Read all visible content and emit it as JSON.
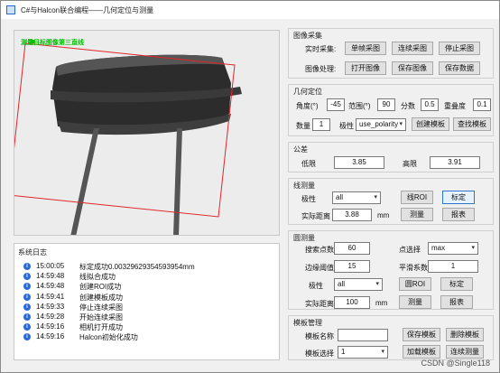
{
  "window": {
    "title": "C#与Halcon联合编程——几何定位与测量"
  },
  "viewer": {
    "overlay_text": "测量目标图像第三直线"
  },
  "system_log": {
    "title": "系统日志",
    "entries": [
      {
        "time": "15:00:05",
        "message": "标定成功0.0032962935459395​4mm"
      },
      {
        "time": "14:59:48",
        "message": "线拟合成功"
      },
      {
        "time": "14:59:48",
        "message": "创建ROI成功"
      },
      {
        "time": "14:59:41",
        "message": "创建模板成功"
      },
      {
        "time": "14:59:33",
        "message": "停止连续采图"
      },
      {
        "time": "14:59:28",
        "message": "开始连续采图"
      },
      {
        "time": "14:59:16",
        "message": "相机打开成功"
      },
      {
        "time": "14:59:16",
        "message": "Halcon初始化成功"
      }
    ]
  },
  "image_acquisition": {
    "title": "图像采集",
    "realtime_label": "实时采集:",
    "single_capture": "单帧采图",
    "continuous_capture": "连续采图",
    "stop_capture": "停止采图",
    "processing_label": "图像处理:",
    "open_image": "打开图像",
    "save_image": "保存图像",
    "save_data": "保存数据"
  },
  "geo_locate": {
    "title": "几何定位",
    "angle_label": "角度(°)",
    "angle_value": "-45",
    "range_label": "范围(°)",
    "range_value": "90",
    "score_label": "分数",
    "score_value": "0.5",
    "overlap_label": "重叠度",
    "overlap_value": "0.1",
    "count_label": "数量",
    "count_value": "1",
    "polarity_label": "极性",
    "polarity_value": "use_polarity",
    "create_template": "创建模板",
    "find_template": "查找模板"
  },
  "tolerance": {
    "title": "公差",
    "low_label": "低限",
    "low_value": "3.85",
    "high_label": "高限",
    "high_value": "3.91"
  },
  "line_measure": {
    "title": "线测量",
    "polarity_label": "极性",
    "polarity_value": "all",
    "line_roi": "线ROI",
    "calibrate": "标定",
    "distance_label": "实际距离",
    "distance_value": "3.88",
    "unit": "mm",
    "measure": "测量",
    "report": "报表"
  },
  "circle_measure": {
    "title": "圆测量",
    "search_points_label": "搜索点数",
    "search_points_value": "60",
    "point_select_label": "点选择",
    "point_select_value": "max",
    "edge_threshold_label": "边缘阈值",
    "edge_threshold_value": "15",
    "smooth_label": "平滑系数",
    "smooth_value": "1",
    "polarity_label": "极性",
    "polarity_value": "all",
    "circle_roi": "圆ROI",
    "calibrate": "标定",
    "distance_label": "实际距离",
    "distance_value": "100",
    "unit": "mm",
    "measure": "测量",
    "report": "报表"
  },
  "template_manage": {
    "title": "模板管理",
    "name_label": "模板名称",
    "name_value": "",
    "save_template": "保存模板",
    "delete_template": "删除模板",
    "select_label": "模板选择",
    "select_value": "1",
    "load_template": "加载模板",
    "continuous_measure": "连续测量"
  },
  "watermark": "CSDN @Single118",
  "colors": {
    "roi_rect": "#e0262b",
    "overlay_text": "#00c000",
    "log_bullet": "#2a6ad6",
    "focused_button": "#2f74d0"
  }
}
